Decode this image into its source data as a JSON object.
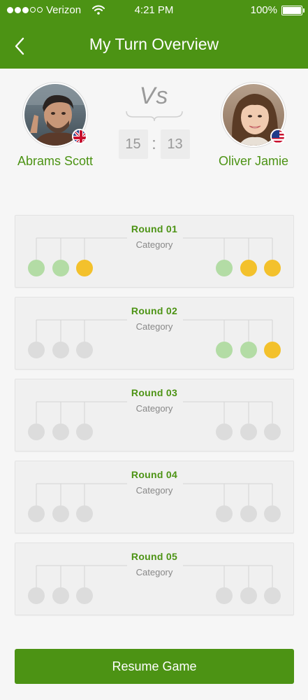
{
  "status_bar": {
    "carrier": "Verizon",
    "signal_dots_filled": 3,
    "signal_dots_total": 5,
    "time": "4:21 PM",
    "battery_percent": "100%"
  },
  "header": {
    "title": "My Turn Overview",
    "back_icon": "chevron-left-icon"
  },
  "player_left": {
    "name": "Abrams Scott",
    "flag": "uk-flag-icon"
  },
  "player_right": {
    "name": "Oliver Jamie",
    "flag": "us-flag-icon"
  },
  "versus": {
    "label": "Vs",
    "timer_left": "15",
    "timer_separator": ":",
    "timer_right": "13"
  },
  "rounds": [
    {
      "title": "Round 01",
      "category": "Category",
      "left": [
        "correct",
        "correct",
        "pending"
      ],
      "right": [
        "correct",
        "pending",
        "pending"
      ]
    },
    {
      "title": "Round 02",
      "category": "Category",
      "left": [
        "empty",
        "empty",
        "empty"
      ],
      "right": [
        "correct",
        "correct",
        "pending"
      ]
    },
    {
      "title": "Round 03",
      "category": "Category",
      "left": [
        "empty",
        "empty",
        "empty"
      ],
      "right": [
        "empty",
        "empty",
        "empty"
      ]
    },
    {
      "title": "Round 04",
      "category": "Category",
      "left": [
        "empty",
        "empty",
        "empty"
      ],
      "right": [
        "empty",
        "empty",
        "empty"
      ]
    },
    {
      "title": "Round 05",
      "category": "Category",
      "left": [
        "empty",
        "empty",
        "empty"
      ],
      "right": [
        "empty",
        "empty",
        "empty"
      ]
    }
  ],
  "resume_button": "Resume Game",
  "colors": {
    "brand_green": "#4c9314",
    "correct": "#b3dca5",
    "pending": "#f3c12c",
    "empty": "#dcdcdc"
  }
}
